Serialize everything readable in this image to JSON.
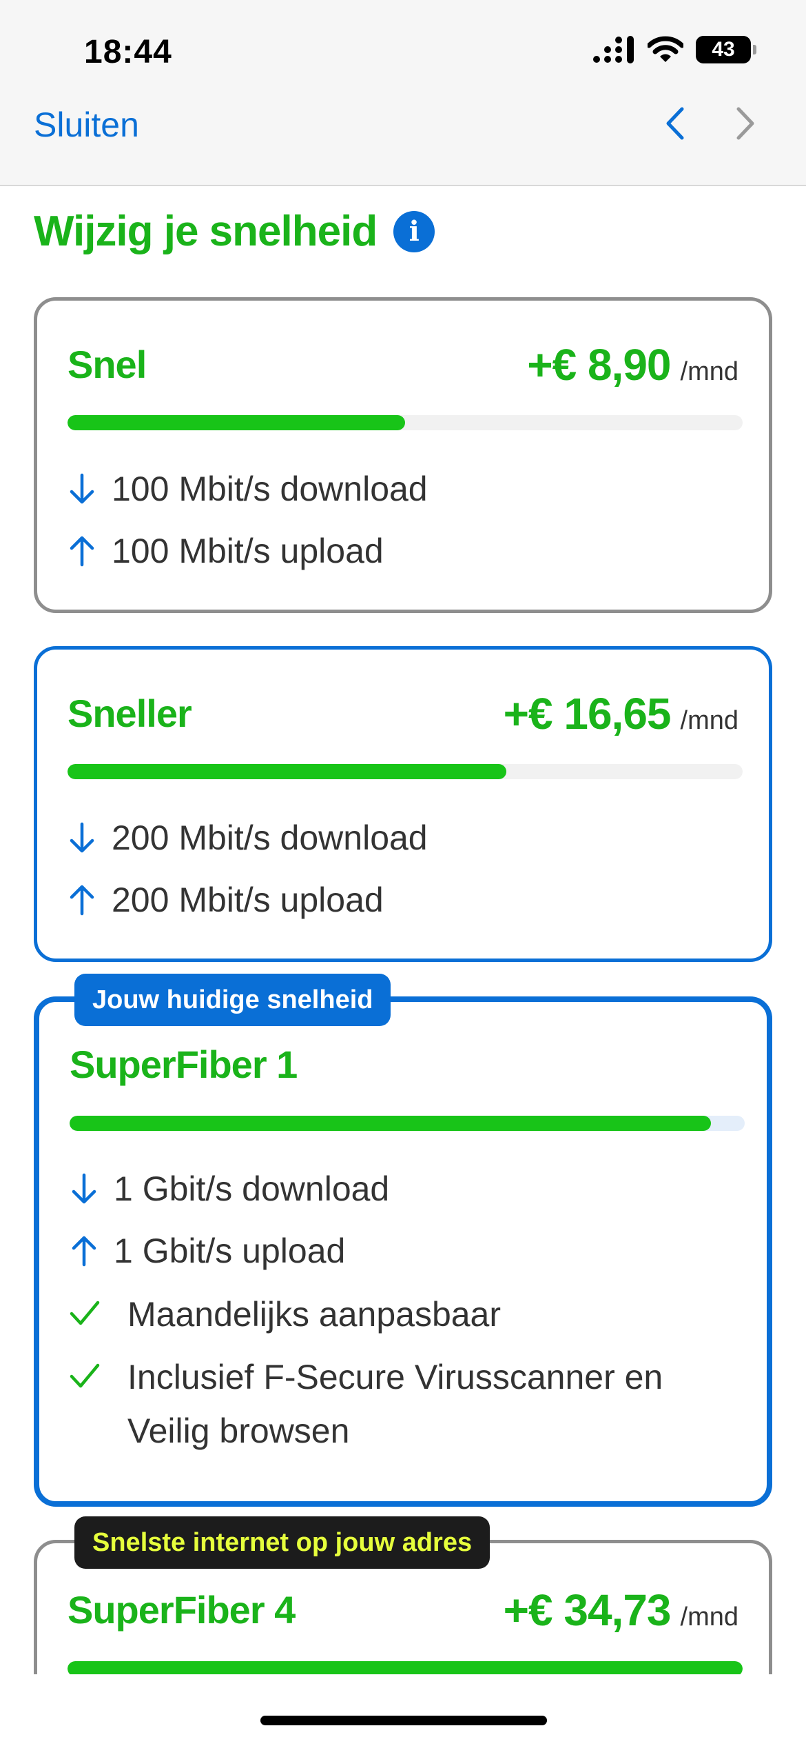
{
  "status": {
    "time": "18:44",
    "battery": "43"
  },
  "nav": {
    "close_label": "Sluiten"
  },
  "page": {
    "title": "Wijzig je snelheid"
  },
  "plans": [
    {
      "name": "Snel",
      "price": "+€ 8,90",
      "unit": "/mnd",
      "speed_fraction": 0.5,
      "download": "100 Mbit/s download",
      "upload": "100 Mbit/s upload"
    },
    {
      "name": "Sneller",
      "price": "+€ 16,65",
      "unit": "/mnd",
      "speed_fraction": 0.65,
      "download": "200 Mbit/s download",
      "upload": "200 Mbit/s upload"
    },
    {
      "name": "SuperFiber 1",
      "badge": "Jouw huidige snelheid",
      "speed_fraction": 0.95,
      "download": "1 Gbit/s download",
      "upload": "1 Gbit/s upload",
      "features": [
        "Maandelijks aanpasbaar",
        "Inclusief F-Secure Virusscanner en Veilig browsen"
      ]
    },
    {
      "name": "SuperFiber 4",
      "badge": "Snelste internet op jouw adres",
      "price": "+€ 34,73",
      "unit": "/mnd",
      "speed_fraction": 1.0
    }
  ],
  "colors": {
    "accent_blue": "#0a6fd6",
    "brand_green": "#1ab31a",
    "bar_green": "#18c418",
    "badge_yellow": "#e6ff3c"
  }
}
